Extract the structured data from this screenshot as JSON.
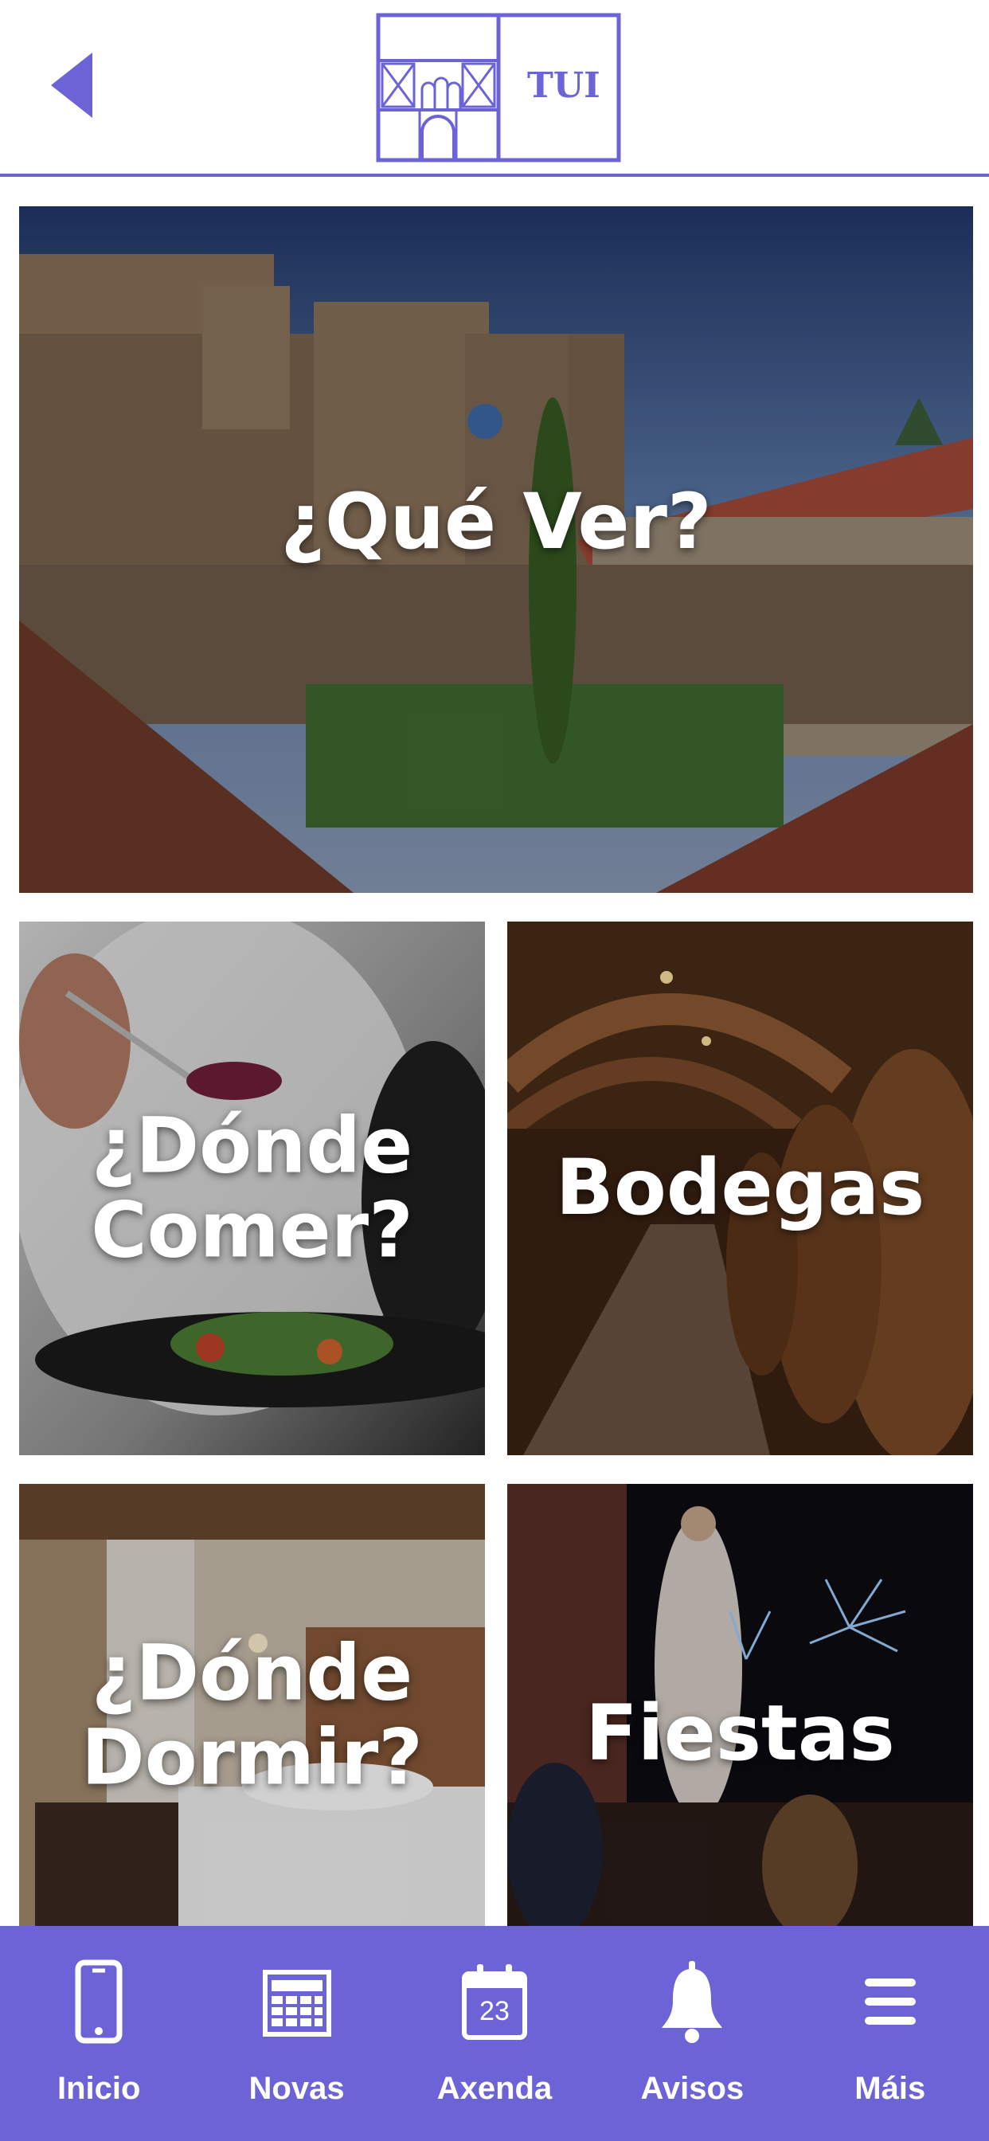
{
  "header": {
    "logo_text": "TUI",
    "accent_color": "#6b63d6",
    "back_icon": "chevron-left-icon"
  },
  "tiles": [
    {
      "label": "¿Qué Ver?",
      "photo": "cathedral-cloister"
    },
    {
      "label": "¿Dónde\nComer?",
      "photo": "chef-plating-dish"
    },
    {
      "label": "Bodegas",
      "photo": "wine-cellar-barrels"
    },
    {
      "label": "¿Dónde\nDormir?",
      "photo": "hotel-room-bed"
    },
    {
      "label": "Fiestas",
      "photo": "night-procession-fireworks"
    }
  ],
  "tabbar": {
    "background": "#6b63d6",
    "items": [
      {
        "label": "Inicio",
        "icon": "phone-icon"
      },
      {
        "label": "Novas",
        "icon": "newspaper-icon"
      },
      {
        "label": "Axenda",
        "icon": "calendar-icon",
        "icon_text": "23"
      },
      {
        "label": "Avisos",
        "icon": "bell-icon"
      },
      {
        "label": "Máis",
        "icon": "menu-icon"
      }
    ]
  }
}
